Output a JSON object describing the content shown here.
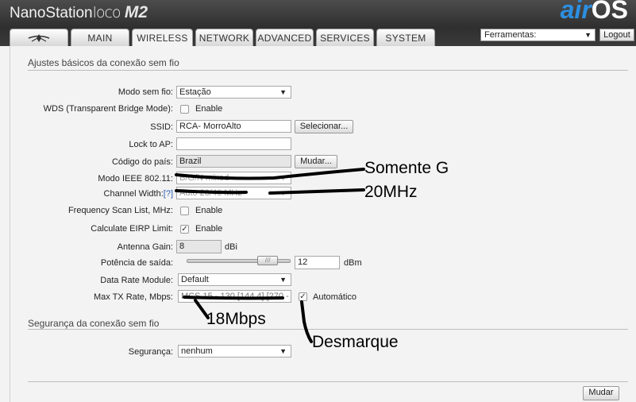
{
  "header": {
    "brand_name": "NanoStation",
    "brand_model": "loco",
    "brand_suffix": "M2",
    "logo_air": "air",
    "logo_os": "OS",
    "tools_value": "Ferramentas:",
    "logout_label": "Logout"
  },
  "tabs": [
    {
      "label": "MAIN"
    },
    {
      "label": "WIRELESS",
      "active": true
    },
    {
      "label": "NETWORK"
    },
    {
      "label": "ADVANCED"
    },
    {
      "label": "SERVICES"
    },
    {
      "label": "SYSTEM"
    }
  ],
  "basic": {
    "title": "Ajustes básicos da conexão sem fio",
    "wireless_mode_label": "Modo sem fio:",
    "wireless_mode_value": "Estação",
    "wds_label": "WDS (Transparent Bridge Mode):",
    "wds_enable": "Enable",
    "ssid_label": "SSID:",
    "ssid_value": "RCA- MorroAlto",
    "select_button": "Selecionar...",
    "lock_ap_label": "Lock to AP:",
    "lock_ap_value": "",
    "country_label": "Código do país:",
    "country_value": "Brazil",
    "change_button": "Mudar...",
    "ieee_label": "Modo IEEE 802.11:",
    "ieee_value": "B/G/N mixed",
    "channel_width_label": "Channel Width:",
    "channel_width_help": "[?]",
    "channel_width_value": "Auto 20/40 MHz",
    "freq_scan_label": "Frequency Scan List, MHz:",
    "freq_scan_enable": "Enable",
    "eirp_label": "Calculate EIRP Limit:",
    "eirp_enable": "Enable",
    "antenna_gain_label": "Antenna Gain:",
    "antenna_gain_value": "8",
    "antenna_gain_unit": "dBi",
    "power_label": "Potência de saída:",
    "power_value": "12",
    "power_unit": "dBm",
    "power_level": 0.85,
    "data_rate_label": "Data Rate Module:",
    "data_rate_value": "Default",
    "max_tx_label": "Max TX Rate, Mbps:",
    "max_tx_value": "MCS 15 - 130 [144.4] [270 - 300]",
    "auto_label": "Automático"
  },
  "security": {
    "title": "Segurança da conexão sem fio",
    "label": "Segurança:",
    "value": "nenhum"
  },
  "footer": {
    "apply_button": "Mudar"
  },
  "annotations": {
    "mode_note": "Somente G",
    "width_note": "20MHz",
    "rate_note": "18Mbps",
    "auto_note": "Desmarque"
  }
}
